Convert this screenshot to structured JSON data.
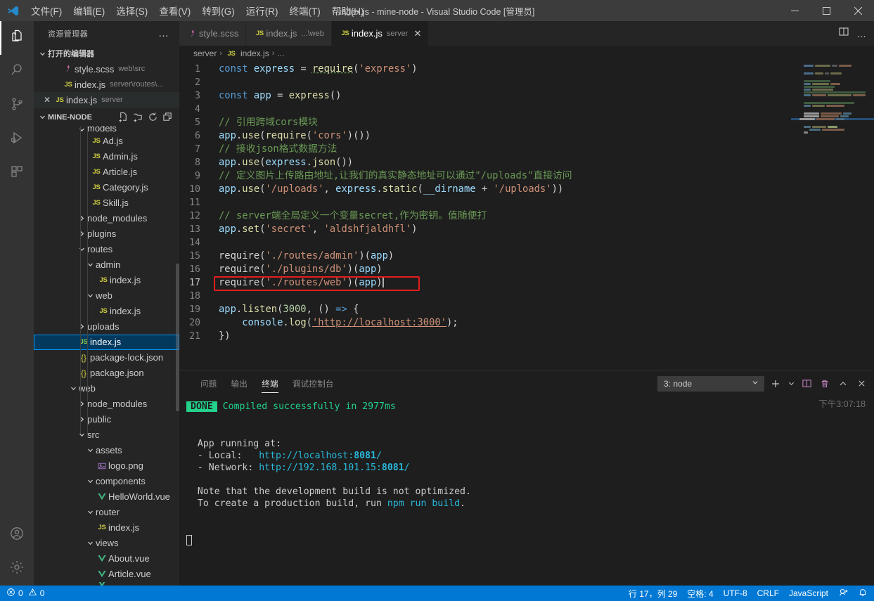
{
  "window": {
    "title": "index.js - mine-node - Visual Studio Code [管理员]",
    "minimize_label": "—",
    "maximize_label": "▢",
    "close_label": "✕"
  },
  "menubar": {
    "items": [
      {
        "label": "文件(F)",
        "name": "menu-file"
      },
      {
        "label": "编辑(E)",
        "name": "menu-edit"
      },
      {
        "label": "选择(S)",
        "name": "menu-selection"
      },
      {
        "label": "查看(V)",
        "name": "menu-view"
      },
      {
        "label": "转到(G)",
        "name": "menu-goto"
      },
      {
        "label": "运行(R)",
        "name": "menu-run"
      },
      {
        "label": "终端(T)",
        "name": "menu-terminal"
      },
      {
        "label": "帮助(H)",
        "name": "menu-help"
      }
    ]
  },
  "activitybar": {
    "items": [
      {
        "icon": "files-explorer-icon",
        "active": true
      },
      {
        "icon": "search-icon",
        "active": false
      },
      {
        "icon": "source-control-icon",
        "active": false
      },
      {
        "icon": "run-and-debug-icon",
        "active": false
      },
      {
        "icon": "extensions-icon",
        "active": false
      }
    ],
    "bottom": [
      {
        "icon": "account-icon"
      },
      {
        "icon": "gear-icon"
      }
    ]
  },
  "sidebar": {
    "title": "资源管理器",
    "more_actions": "…",
    "open_editors": {
      "label": "打开的编辑器",
      "expanded": true,
      "items": [
        {
          "icon": "scss-file-icon",
          "name": "style.scss",
          "desc": "web\\src",
          "active": false,
          "close": false
        },
        {
          "icon": "js-file-icon",
          "name": "index.js",
          "desc": "server\\routes\\...",
          "active": false,
          "close": false
        },
        {
          "icon": "js-file-icon",
          "name": "index.js",
          "desc": "server",
          "active": true,
          "close": true
        }
      ]
    },
    "project": {
      "label": "MINE-NODE",
      "expanded": true,
      "actions": [
        "new-file-icon",
        "new-folder-icon",
        "refresh-icon",
        "collapse-all-icon"
      ],
      "tree": [
        {
          "label": "models",
          "type": "folder",
          "state": "open",
          "depth": 2,
          "clipped": true
        },
        {
          "label": "Ad.js",
          "type": "js",
          "depth": 3
        },
        {
          "label": "Admin.js",
          "type": "js",
          "depth": 3
        },
        {
          "label": "Article.js",
          "type": "js",
          "depth": 3
        },
        {
          "label": "Category.js",
          "type": "js",
          "depth": 3
        },
        {
          "label": "Skill.js",
          "type": "js",
          "depth": 3
        },
        {
          "label": "node_modules",
          "type": "folder",
          "state": "closed",
          "depth": 2
        },
        {
          "label": "plugins",
          "type": "folder",
          "state": "closed",
          "depth": 2
        },
        {
          "label": "routes",
          "type": "folder",
          "state": "open",
          "depth": 2
        },
        {
          "label": "admin",
          "type": "folder",
          "state": "open",
          "depth": 3
        },
        {
          "label": "index.js",
          "type": "js",
          "depth": 4
        },
        {
          "label": "web",
          "type": "folder",
          "state": "open",
          "depth": 3
        },
        {
          "label": "index.js",
          "type": "js",
          "depth": 4
        },
        {
          "label": "uploads",
          "type": "folder",
          "state": "closed",
          "depth": 2
        },
        {
          "label": "index.js",
          "type": "js",
          "depth": 2,
          "selected": true
        },
        {
          "label": "package-lock.json",
          "type": "json",
          "depth": 2
        },
        {
          "label": "package.json",
          "type": "json",
          "depth": 2
        },
        {
          "label": "web",
          "type": "folder",
          "state": "open",
          "depth": 1
        },
        {
          "label": "node_modules",
          "type": "folder",
          "state": "closed",
          "depth": 2
        },
        {
          "label": "public",
          "type": "folder",
          "state": "closed",
          "depth": 2
        },
        {
          "label": "src",
          "type": "folder",
          "state": "open",
          "depth": 2
        },
        {
          "label": "assets",
          "type": "folder",
          "state": "open",
          "depth": 3
        },
        {
          "label": "logo.png",
          "type": "png",
          "depth": 4
        },
        {
          "label": "components",
          "type": "folder",
          "state": "open",
          "depth": 3
        },
        {
          "label": "HelloWorld.vue",
          "type": "vue",
          "depth": 4
        },
        {
          "label": "router",
          "type": "folder",
          "state": "open",
          "depth": 3
        },
        {
          "label": "index.js",
          "type": "js",
          "depth": 4
        },
        {
          "label": "views",
          "type": "folder",
          "state": "open",
          "depth": 3
        },
        {
          "label": "About.vue",
          "type": "vue",
          "depth": 4
        },
        {
          "label": "Article.vue",
          "type": "vue",
          "depth": 4
        }
      ]
    }
  },
  "tabs": {
    "items": [
      {
        "icon": "scss-file-icon",
        "label": "style.scss",
        "desc": "",
        "active": false,
        "close": false
      },
      {
        "icon": "js-file-icon",
        "label": "index.js",
        "desc": "...\\web",
        "active": false,
        "close": false
      },
      {
        "icon": "js-file-icon",
        "label": "index.js",
        "desc": "server",
        "active": true,
        "close": true
      }
    ],
    "actions": [
      {
        "icon": "split-editor-icon"
      },
      {
        "icon": "more-actions-icon"
      }
    ]
  },
  "breadcrumb": {
    "parts": [
      "server",
      "index.js",
      "..."
    ],
    "separator": "›"
  },
  "editor": {
    "highlight_color": "#e41d1d",
    "lines": [
      {
        "n": 1,
        "tokens": [
          {
            "t": "const",
            "c": "key"
          },
          {
            "t": " ",
            "c": "pl"
          },
          {
            "t": "express",
            "c": "var"
          },
          {
            "t": " = ",
            "c": "pl"
          },
          {
            "t": "require",
            "c": "ylw"
          },
          {
            "t": "(",
            "c": "pl"
          },
          {
            "t": "'express'",
            "c": "str"
          },
          {
            "t": ")",
            "c": "pl"
          }
        ]
      },
      {
        "n": 2,
        "tokens": []
      },
      {
        "n": 3,
        "tokens": [
          {
            "t": "const",
            "c": "key"
          },
          {
            "t": " ",
            "c": "pl"
          },
          {
            "t": "app",
            "c": "var"
          },
          {
            "t": " = ",
            "c": "pl"
          },
          {
            "t": "express",
            "c": "ylw"
          },
          {
            "t": "()",
            "c": "pl"
          }
        ]
      },
      {
        "n": 4,
        "tokens": []
      },
      {
        "n": 5,
        "tokens": [
          {
            "t": "// 引用跨域cors模块",
            "c": "cmt"
          }
        ]
      },
      {
        "n": 6,
        "tokens": [
          {
            "t": "app",
            "c": "var"
          },
          {
            "t": ".",
            "c": "pl"
          },
          {
            "t": "use",
            "c": "ylw"
          },
          {
            "t": "(",
            "c": "pl"
          },
          {
            "t": "require",
            "c": "ylw"
          },
          {
            "t": "(",
            "c": "pl"
          },
          {
            "t": "'cors'",
            "c": "str"
          },
          {
            "t": ")())",
            "c": "pl"
          }
        ]
      },
      {
        "n": 7,
        "tokens": [
          {
            "t": "// 接收json格式数据方法",
            "c": "cmt"
          }
        ]
      },
      {
        "n": 8,
        "tokens": [
          {
            "t": "app",
            "c": "var"
          },
          {
            "t": ".",
            "c": "pl"
          },
          {
            "t": "use",
            "c": "ylw"
          },
          {
            "t": "(",
            "c": "pl"
          },
          {
            "t": "express",
            "c": "var"
          },
          {
            "t": ".",
            "c": "pl"
          },
          {
            "t": "json",
            "c": "ylw"
          },
          {
            "t": "())",
            "c": "pl"
          }
        ]
      },
      {
        "n": 9,
        "tokens": [
          {
            "t": "// 定义图片上传路由地址,让我们的真实静态地址可以通过\"/uploads\"直接访问",
            "c": "cmt"
          }
        ]
      },
      {
        "n": 10,
        "tokens": [
          {
            "t": "app",
            "c": "var"
          },
          {
            "t": ".",
            "c": "pl"
          },
          {
            "t": "use",
            "c": "ylw"
          },
          {
            "t": "(",
            "c": "pl"
          },
          {
            "t": "'/uploads'",
            "c": "str"
          },
          {
            "t": ", ",
            "c": "pl"
          },
          {
            "t": "express",
            "c": "var"
          },
          {
            "t": ".",
            "c": "pl"
          },
          {
            "t": "static",
            "c": "ylw"
          },
          {
            "t": "(",
            "c": "pl"
          },
          {
            "t": "__dirname",
            "c": "var"
          },
          {
            "t": " + ",
            "c": "pl"
          },
          {
            "t": "'/uploads'",
            "c": "str"
          },
          {
            "t": "))",
            "c": "pl"
          }
        ]
      },
      {
        "n": 11,
        "tokens": []
      },
      {
        "n": 12,
        "tokens": [
          {
            "t": "// server端全局定义一个变量secret,作为密钥。值随便打",
            "c": "cmt"
          }
        ]
      },
      {
        "n": 13,
        "tokens": [
          {
            "t": "app",
            "c": "var"
          },
          {
            "t": ".",
            "c": "pl"
          },
          {
            "t": "set",
            "c": "ylw"
          },
          {
            "t": "(",
            "c": "pl"
          },
          {
            "t": "'secret'",
            "c": "str"
          },
          {
            "t": ", ",
            "c": "pl"
          },
          {
            "t": "'aldshfjaldhfl'",
            "c": "str"
          },
          {
            "t": ")",
            "c": "pl"
          }
        ]
      },
      {
        "n": 14,
        "tokens": []
      },
      {
        "n": 15,
        "tokens": [
          {
            "t": "require",
            "c": "pl"
          },
          {
            "t": "(",
            "c": "pl"
          },
          {
            "t": "'./routes/admin'",
            "c": "str"
          },
          {
            "t": ")(",
            "c": "pl"
          },
          {
            "t": "app",
            "c": "var"
          },
          {
            "t": ")",
            "c": "pl"
          }
        ]
      },
      {
        "n": 16,
        "tokens": [
          {
            "t": "require",
            "c": "pl"
          },
          {
            "t": "(",
            "c": "pl"
          },
          {
            "t": "'./plugins/db'",
            "c": "str"
          },
          {
            "t": ")(",
            "c": "pl"
          },
          {
            "t": "app",
            "c": "var"
          },
          {
            "t": ")",
            "c": "pl"
          }
        ]
      },
      {
        "n": 17,
        "tokens": [
          {
            "t": "require",
            "c": "pl"
          },
          {
            "t": "(",
            "c": "pl"
          },
          {
            "t": "'./routes/web'",
            "c": "str"
          },
          {
            "t": ")(",
            "c": "pl"
          },
          {
            "t": "app",
            "c": "var"
          },
          {
            "t": ")",
            "c": "pl"
          }
        ],
        "highlighted": true,
        "current": true
      },
      {
        "n": 18,
        "tokens": []
      },
      {
        "n": 19,
        "tokens": [
          {
            "t": "app",
            "c": "var"
          },
          {
            "t": ".",
            "c": "pl"
          },
          {
            "t": "listen",
            "c": "ylw"
          },
          {
            "t": "(",
            "c": "pl"
          },
          {
            "t": "3000",
            "c": "num"
          },
          {
            "t": ", () ",
            "c": "pl"
          },
          {
            "t": "=>",
            "c": "key"
          },
          {
            "t": " {",
            "c": "pl"
          }
        ]
      },
      {
        "n": 20,
        "tokens": [
          {
            "t": "    ",
            "c": "pl"
          },
          {
            "t": "console",
            "c": "var"
          },
          {
            "t": ".",
            "c": "pl"
          },
          {
            "t": "log",
            "c": "ylw"
          },
          {
            "t": "(",
            "c": "pl"
          },
          {
            "t": "'http://localhost:3000'",
            "c": "link"
          },
          {
            "t": ");",
            "c": "pl"
          }
        ]
      },
      {
        "n": 21,
        "tokens": [
          {
            "t": "})",
            "c": "pl"
          }
        ]
      }
    ]
  },
  "panel": {
    "tabs": [
      {
        "label": "问题",
        "active": false
      },
      {
        "label": "输出",
        "active": false
      },
      {
        "label": "终端",
        "active": true
      },
      {
        "label": "调试控制台",
        "active": false
      }
    ],
    "terminal_selector": {
      "value": "3: node",
      "chevron": "⌄"
    },
    "actions": [
      {
        "icon": "add-terminal-icon",
        "glyph": "+"
      },
      {
        "icon": "chevron-down-icon",
        "glyph": "⌄"
      },
      {
        "icon": "split-terminal-icon",
        "glyph": "▥"
      },
      {
        "icon": "trash-icon",
        "glyph": "🗑"
      },
      {
        "icon": "chevron-up-maximize-icon",
        "glyph": "^"
      },
      {
        "icon": "close-panel-icon",
        "glyph": "✕"
      }
    ],
    "timestamp": "下午3:07:18",
    "terminal_lines": [
      {
        "type": "done",
        "badge": "DONE",
        "text": " Compiled successfully in 2977ms"
      },
      {
        "type": "blank"
      },
      {
        "type": "blank"
      },
      {
        "type": "plain",
        "text": "  App running at:"
      },
      {
        "type": "local",
        "prefix": "  - Local:   ",
        "url": "http://localhost:",
        "port": "8081",
        "suffix": "/"
      },
      {
        "type": "network",
        "prefix": "  - Network: ",
        "url": "http://192.168.101.15:",
        "port": "8081",
        "suffix": "/"
      },
      {
        "type": "blank"
      },
      {
        "type": "plain",
        "text": "  Note that the development build is not optimized."
      },
      {
        "type": "build",
        "prefix": "  To create a production build, run ",
        "cmd": "npm run build",
        "suffix": "."
      },
      {
        "type": "blank"
      },
      {
        "type": "blank"
      },
      {
        "type": "cursor"
      }
    ]
  },
  "statusbar": {
    "left": [
      {
        "name": "problems-status",
        "icon": "error-icon",
        "text": "0",
        "icon2": "warning-icon",
        "text2": "0"
      }
    ],
    "right": [
      {
        "name": "cursor-position",
        "label": "行 17，列 29"
      },
      {
        "name": "indentation",
        "label": "空格: 4"
      },
      {
        "name": "encoding",
        "label": "UTF-8"
      },
      {
        "name": "eol",
        "label": "CRLF"
      },
      {
        "name": "language-mode",
        "label": "JavaScript"
      },
      {
        "name": "tweet-feedback",
        "label": ""
      },
      {
        "name": "notifications",
        "label": ""
      }
    ],
    "background": "#0078d4"
  }
}
